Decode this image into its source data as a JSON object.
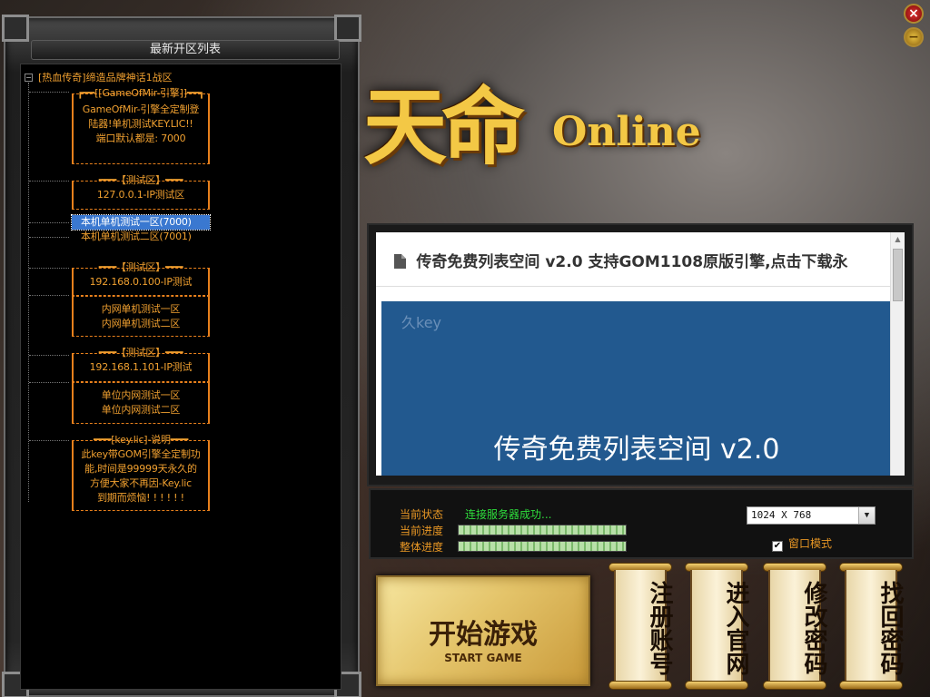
{
  "server_list": {
    "title": "最新开区列表",
    "root_label": "[热血传奇]缔造品牌神话1战区",
    "expander": "−",
    "groups": [
      {
        "header": "┏━━[[GameOfMir-引擎]]━━┓",
        "lines": [
          "GameOfMir-引擎全定制登",
          "陆器!单机测试KEY.LIC!!",
          "端口默认都是: 7000"
        ]
      },
      {
        "header": "━━━【测试区】━━━",
        "lines": [
          "127.0.0.1-IP测试区"
        ]
      },
      {
        "items": [
          "本机单机测试一区(7000)",
          "本机单机测试二区(7001)"
        ],
        "selected": 0
      },
      {
        "header": "━━━【测试区】━━━",
        "lines": [
          "192.168.0.100-IP测试"
        ]
      },
      {
        "lines": [
          "内网单机测试一区",
          "内网单机测试二区"
        ]
      },
      {
        "header": "━━━【测试区】━━━",
        "lines": [
          "192.168.1.101-IP测试"
        ]
      },
      {
        "lines": [
          "单位内网测试一区",
          "单位内网测试二区"
        ]
      },
      {
        "header": "━━━[key.lic]-说明━━━",
        "lines": [
          "此key带GOM引擎全定制功",
          "能,时间是99999天永久的",
          "方便大家不再因-Key.lic",
          "到期而烦恼! ! ! ! ! !"
        ]
      }
    ]
  },
  "logo": {
    "main": "天命",
    "sub": "Online"
  },
  "window_controls": {
    "close": "×",
    "minimize": "−"
  },
  "web": {
    "doc_icon": "document-icon",
    "header": "传奇免费列表空间 v2.0 支持GOM1108原版引擎,点击下载永",
    "banner_key": "久key",
    "banner_title": "传奇免费列表空间 v2.0",
    "banner_color": "#22598f"
  },
  "status": {
    "state_label": "当前状态",
    "state_value": "连接服务器成功...",
    "progress_label": "当前进度",
    "total_label": "整体进度",
    "progress": 1.0,
    "total": 1.0,
    "resolution": "1024 X 768",
    "resolution_arrow": "▼",
    "window_mode_label": "窗口模式",
    "window_mode_checked": "✔"
  },
  "buttons": {
    "start_cn": "开始游戏",
    "start_en": "START GAME",
    "register": "注册账号",
    "website": "进入官网",
    "change_pwd": "修改密码",
    "recover_pwd": "找回密码"
  },
  "colors": {
    "list_text": "#f0a030",
    "status_ok": "#2ede3c",
    "gold": "#f3c845"
  }
}
